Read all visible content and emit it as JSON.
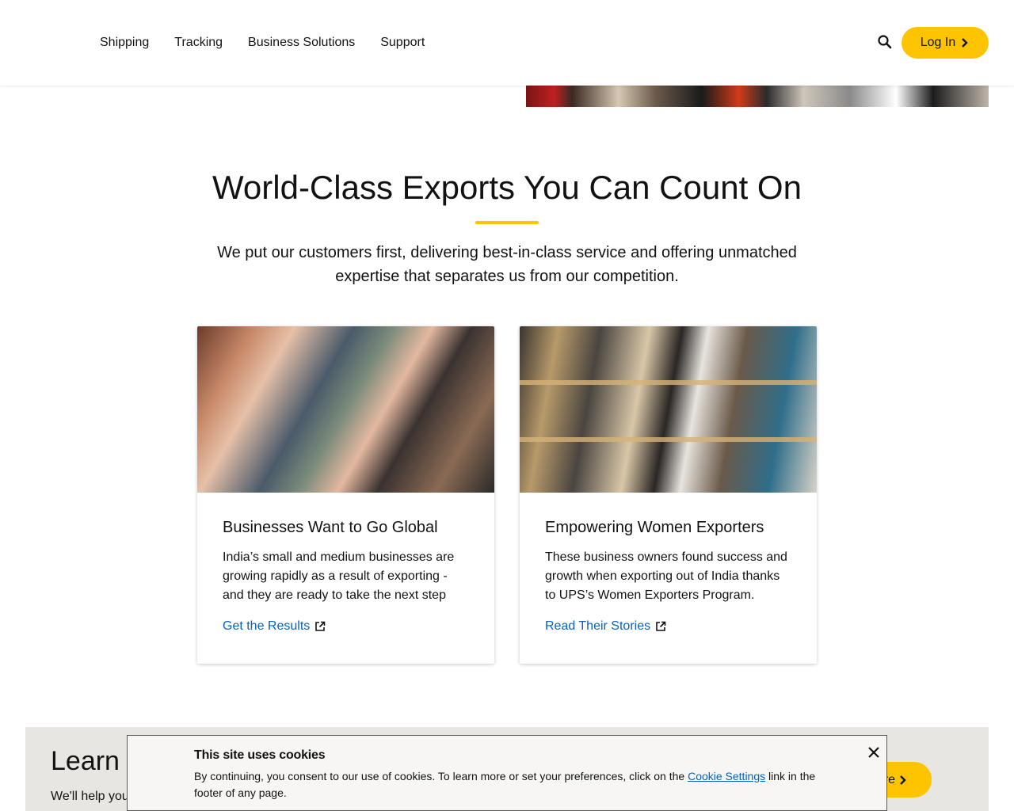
{
  "header": {
    "nav_items": [
      "Shipping",
      "Tracking",
      "Business Solutions",
      "Support"
    ],
    "search_icon": "search-icon",
    "login_label": "Log In",
    "accent_color": "#ffc400"
  },
  "section": {
    "title": "World-Class Exports You Can Count On",
    "subtitle": "We put our customers first, delivering best-in-class service and offering unmatched expertise that separates us from our competition."
  },
  "cards": [
    {
      "title": "Businesses Want to Go Global",
      "text": "India’s small and medium businesses are growing rapidly as a result of exporting - and they are ready to take the next step",
      "link": "Get the Results",
      "link_icon": "external-link-icon"
    },
    {
      "title": "Empowering Women Exporters",
      "text": "These business owners found success and growth when exporting out of India thanks to UPS’s Women Exporters Program.",
      "link": "Read Their Stories",
      "link_icon": "external-link-icon"
    }
  ],
  "band": {
    "title": "Learn M",
    "text": "We'll help you",
    "button_label": "re"
  },
  "cookie": {
    "title": "This site uses cookies",
    "text_before": "By continuing, you consent to our use of cookies. To learn more or set your preferences, click on the ",
    "link": "Cookie Settings",
    "text_after": " link in the footer of any page.",
    "close_icon": "close-icon",
    "link_color": "#0662bb"
  }
}
